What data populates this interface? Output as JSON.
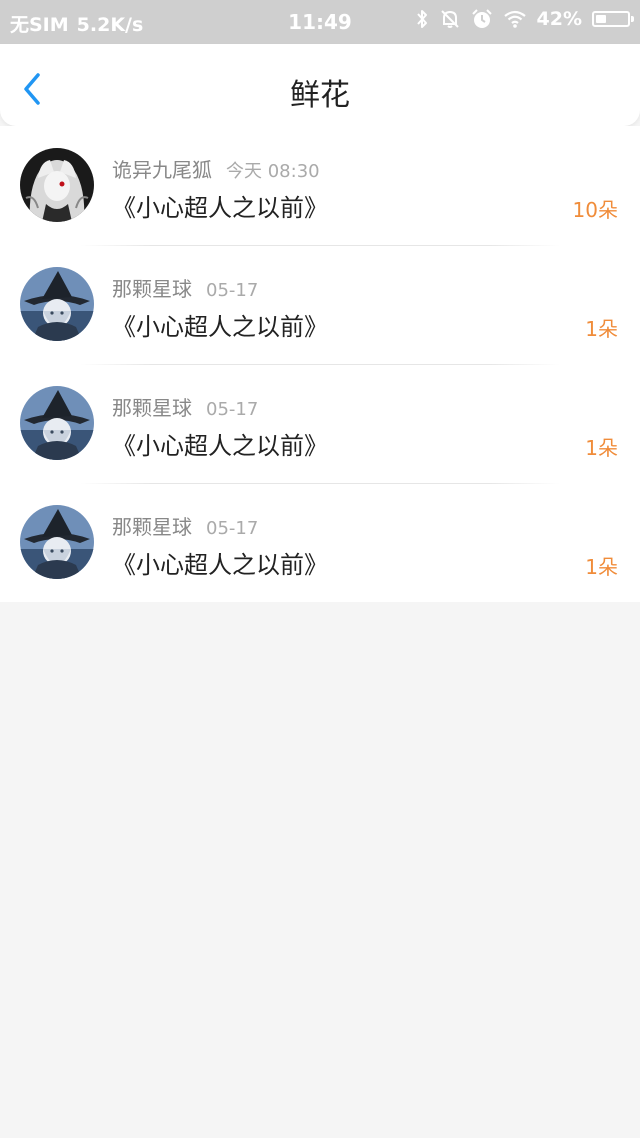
{
  "status_bar": {
    "carrier": "无SIM",
    "speed": "5.2K/s",
    "time": "11:49",
    "battery_percent": "42%",
    "battery_level": 0.42,
    "icons": [
      "bluetooth-icon",
      "muted-bell-icon",
      "alarm-icon",
      "wifi-icon",
      "battery-icon"
    ]
  },
  "nav": {
    "back_icon": "chevron-left-icon",
    "title": "鲜花",
    "accent_color": "#2196f3"
  },
  "items": [
    {
      "name": "诡异九尾狐",
      "time": "今天 08:30",
      "book": "《小心超人之以前》",
      "count": "10朵",
      "avatar": "fox-girl-avatar"
    },
    {
      "name": "那颗星球",
      "time": "05-17",
      "book": "《小心超人之以前》",
      "count": "1朵",
      "avatar": "witch-avatar"
    },
    {
      "name": "那颗星球",
      "time": "05-17",
      "book": "《小心超人之以前》",
      "count": "1朵",
      "avatar": "witch-avatar"
    },
    {
      "name": "那颗星球",
      "time": "05-17",
      "book": "《小心超人之以前》",
      "count": "1朵",
      "avatar": "witch-avatar"
    }
  ],
  "colors": {
    "count": "#f08c3a",
    "status_bar_bg": "#cfcfcf",
    "page_bg": "#f5f5f5"
  }
}
